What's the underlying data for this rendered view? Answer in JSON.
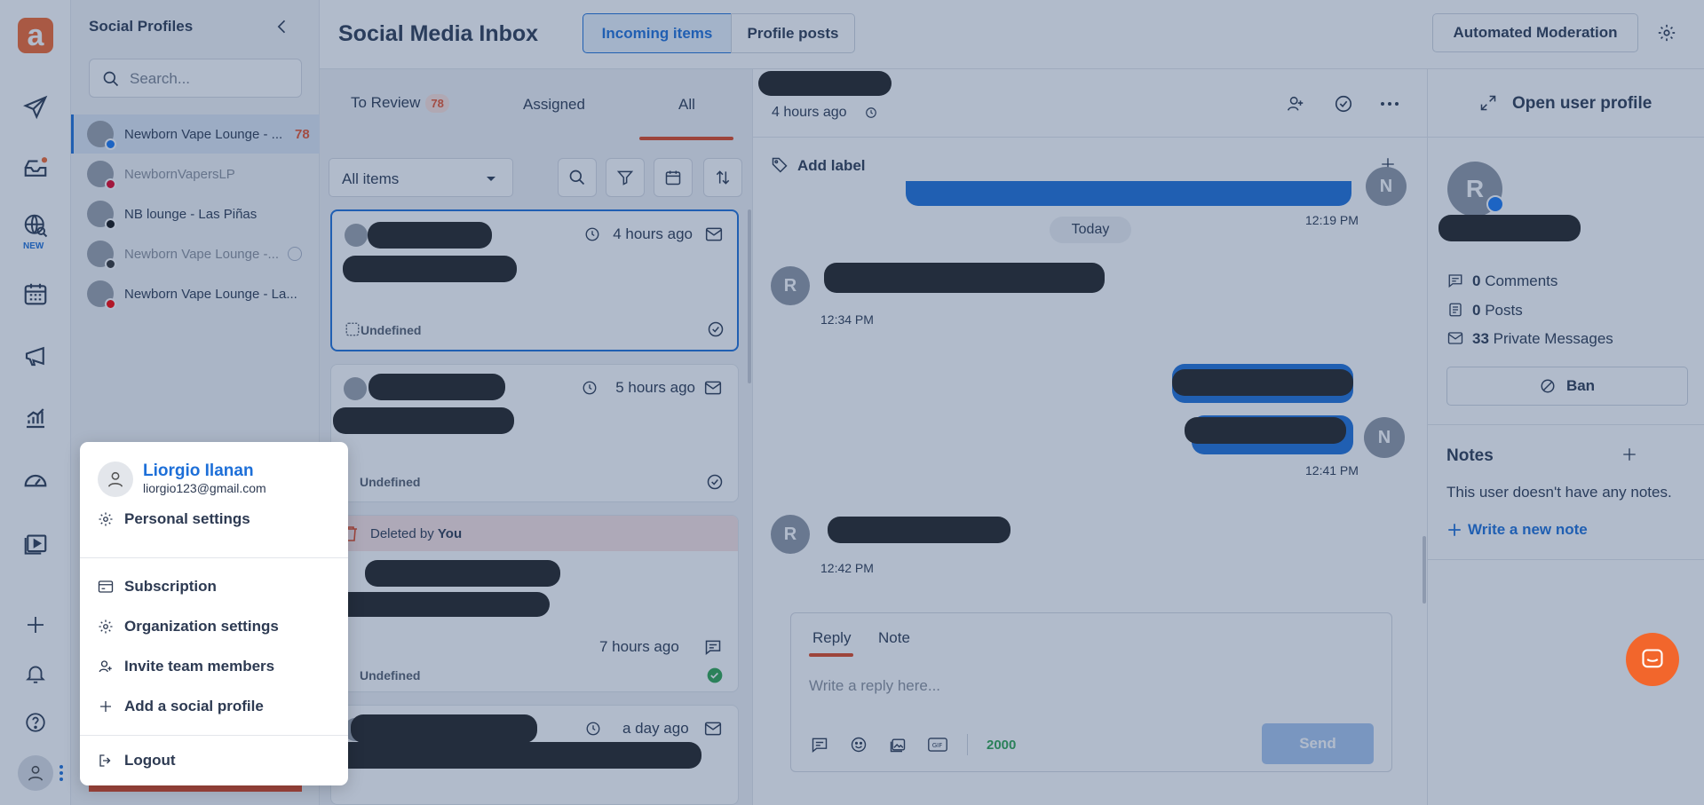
{
  "colors": {
    "accent": "#f2662c",
    "primary_blue": "#1d6fd8",
    "badge_red": "#e8542c",
    "green": "#2ea44f"
  },
  "rail": {
    "logo_letter": "a",
    "new_badge": "NEW",
    "icons": [
      "send-icon",
      "inbox-icon",
      "listening-icon",
      "calendar-icon",
      "megaphone-icon",
      "analytics-icon",
      "dashboard-icon",
      "media-library-icon",
      "plus-icon",
      "bell-icon",
      "help-icon",
      "user-icon",
      "more-dots-icon"
    ]
  },
  "profiles": {
    "title": "Social Profiles",
    "search_placeholder": "Search...",
    "items": [
      {
        "name": "Newborn Vape Lounge - ...",
        "count": "78",
        "network": "facebook"
      },
      {
        "name": "NewbornVapersLP",
        "count": "",
        "network": "pinterest"
      },
      {
        "name": "NB lounge - Las Piñas",
        "count": "",
        "network": "tiktok"
      },
      {
        "name": "Newborn Vape Lounge -...",
        "count": "",
        "network": "twitter"
      },
      {
        "name": "Newborn Vape Lounge - La...",
        "count": "",
        "network": "youtube"
      }
    ]
  },
  "header": {
    "title": "Social Media Inbox",
    "tab_incoming": "Incoming items",
    "tab_posts": "Profile posts",
    "automated_moderation": "Automated Moderation"
  },
  "items": {
    "tabs": {
      "to_review": "To Review",
      "to_review_count": "78",
      "assigned": "Assigned",
      "all": "All"
    },
    "filter": "All items",
    "cards": [
      {
        "time": "4 hours ago",
        "status": "Undefined"
      },
      {
        "time": "5 hours ago",
        "status": "Undefined"
      },
      {
        "deleted_prefix": "Deleted by",
        "deleted_by": "You",
        "time": "7 hours ago",
        "status": "Undefined"
      },
      {
        "time": "a day ago"
      }
    ]
  },
  "conversation": {
    "header_time": "4 hours ago",
    "add_label": "Add label",
    "day_divider": "Today",
    "times": [
      "12:19 PM",
      "12:34 PM",
      "12:41 PM",
      "12:42 PM"
    ],
    "avatar_r": "R",
    "avatar_n": "N",
    "reply": {
      "tab_reply": "Reply",
      "tab_note": "Note",
      "placeholder": "Write a reply here...",
      "char_count": "2000",
      "send": "Send"
    }
  },
  "user_panel": {
    "open_profile": "Open user profile",
    "avatar_letter": "R",
    "comments_count": "0",
    "comments_label": "Comments",
    "posts_count": "0",
    "posts_label": "Posts",
    "pm_count": "33",
    "pm_label": "Private Messages",
    "ban": "Ban",
    "notes_title": "Notes",
    "notes_empty": "This user doesn't have any notes.",
    "write_note": "Write a new note"
  },
  "account_menu": {
    "name": "Liorgio Ilanan",
    "email": "liorgio123@gmail.com",
    "personal_settings": "Personal settings",
    "subscription": "Subscription",
    "organization_settings": "Organization settings",
    "invite_team": "Invite team members",
    "add_social": "Add a social profile",
    "logout": "Logout"
  }
}
